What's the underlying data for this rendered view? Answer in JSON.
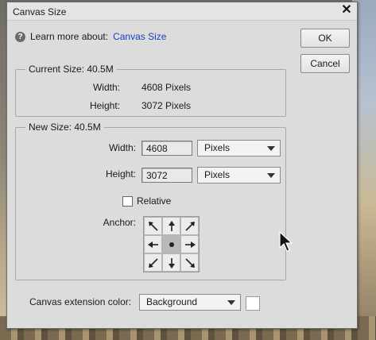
{
  "dialog": {
    "title": "Canvas Size",
    "close_glyph": "✕"
  },
  "learn": {
    "prefix": "Learn more about:",
    "link": "Canvas Size",
    "icon_glyph": "?"
  },
  "buttons": {
    "ok": "OK",
    "cancel": "Cancel"
  },
  "current": {
    "legend": "Current Size: 40.5M",
    "width_label": "Width:",
    "width_value": "4608 Pixels",
    "height_label": "Height:",
    "height_value": "3072 Pixels"
  },
  "new_size": {
    "legend": "New Size: 40.5M",
    "width_label": "Width:",
    "width_value": "4608",
    "width_unit": "Pixels",
    "height_label": "Height:",
    "height_value": "3072",
    "height_unit": "Pixels",
    "relative_label": "Relative",
    "relative_checked": false,
    "anchor_label": "Anchor:",
    "anchor_selected": "center"
  },
  "extension": {
    "label": "Canvas extension color:",
    "value": "Background",
    "swatch_color": "#ffffff"
  }
}
